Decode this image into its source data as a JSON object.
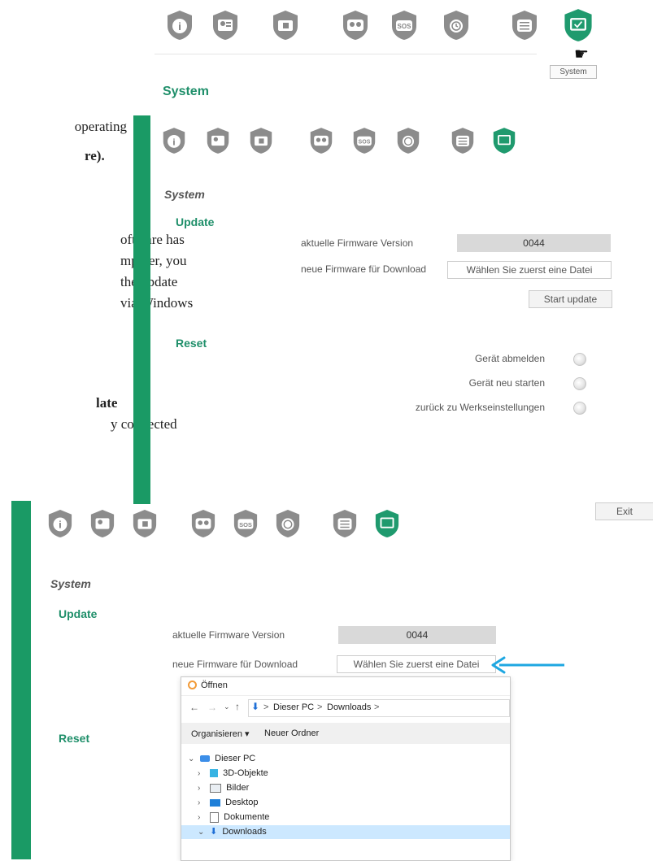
{
  "top_tooltip": "System",
  "top_heading": "System",
  "doc_text": {
    "line1": "operating",
    "line2": "re).",
    "line3a": "oftware  has",
    "line3b": "mputer,  you",
    "line3c": "the  update",
    "line3d": "via Windows",
    "line4": "late",
    "line5": "y connected"
  },
  "panel": {
    "title": "System",
    "update_head": "Update",
    "fw_label": "aktuelle Firmware Version",
    "fw_value": "0044",
    "new_fw_label": "neue Firmware für Download",
    "new_fw_button": "Wählen Sie zuerst eine Datei",
    "start_button": "Start update",
    "reset_head": "Reset",
    "reset_items": [
      "Gerät abmelden",
      "Gerät neu starten",
      "zurück zu Werkseinstellungen"
    ]
  },
  "exit_label": "Exit",
  "dialog": {
    "title": "Öffnen",
    "path_root": "Dieser PC",
    "path_sep": ">",
    "path_folder": "Downloads",
    "organize": "Organisieren ▾",
    "new_folder": "Neuer Ordner",
    "tree": [
      {
        "label": "Dieser PC",
        "expanded": true,
        "indent": 0
      },
      {
        "label": "3D-Objekte",
        "expanded": false,
        "indent": 1
      },
      {
        "label": "Bilder",
        "expanded": false,
        "indent": 1
      },
      {
        "label": "Desktop",
        "expanded": false,
        "indent": 1
      },
      {
        "label": "Dokumente",
        "expanded": false,
        "indent": 1
      },
      {
        "label": "Downloads",
        "expanded": true,
        "indent": 1
      }
    ]
  },
  "colors": {
    "teal": "#1f8f6a",
    "green_bar": "#1a9a65",
    "arrow": "#1ea7e1",
    "highlight": "#cce8ff"
  },
  "icons": [
    "info-icon",
    "contact-icon",
    "sim-icon",
    "group-icon",
    "sos-icon",
    "alarm-icon",
    "settings-icon",
    "system-icon"
  ]
}
